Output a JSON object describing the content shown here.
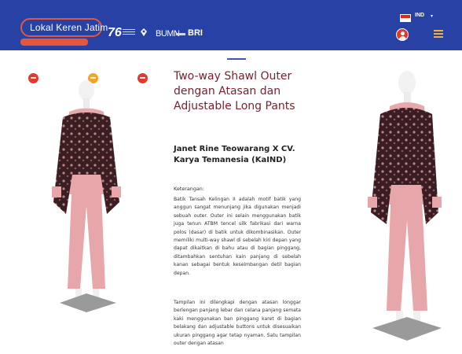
{
  "header": {
    "logo_text": "Lokal Keren Jatim",
    "logo_sub": "",
    "strip": {
      "gov_text": "76",
      "bumn_text": "BUMN",
      "bri_text": "BRI"
    },
    "language": "IND",
    "colors": {
      "background": "#2742a4",
      "accent": "#e7563a",
      "menu": "#f3b13a"
    }
  },
  "product": {
    "title": "Two-way Shawl Outer dengan Atasan dan Adjustable Long Pants",
    "designer": "Janet Rine Teowarang X CV. Karya Temanesia (KaIND)",
    "description_label": "Keterangan:",
    "paragraphs": [
      "Batik Tansah Kelingan II adalah motif batik yang anggun sangat menunjang jika digunakan menjadi sebuah outer. Outer ini selain menggunakan batik juga tenun ATBM tencel silk fabrikasi dari warna polos (dasar) di batik untuk dikombinasikan. Outer memiliki multi-way shawl di sebelah kiri depan yang dapat dikaitkan di bahu atau di bagian pinggang, ditambahkan sentuhan kain panjang di sebelah kanan sebagai bentuk keseimbangan detil bagian depan.",
      "Tampilan ini dilengkapi dengan atasan longgar berlengan panjang lebar dan celana panjang semata kaki menggunakan ban pinggang karet di bagian belakang dan adjustable buttons untuk disesuaikan ukuran pinggang agar tetap nyaman. Satu tampilan outer dengan atasan"
    ]
  },
  "color_options": [
    "#e23a2c",
    "#f1a425",
    "#e23a2c"
  ]
}
